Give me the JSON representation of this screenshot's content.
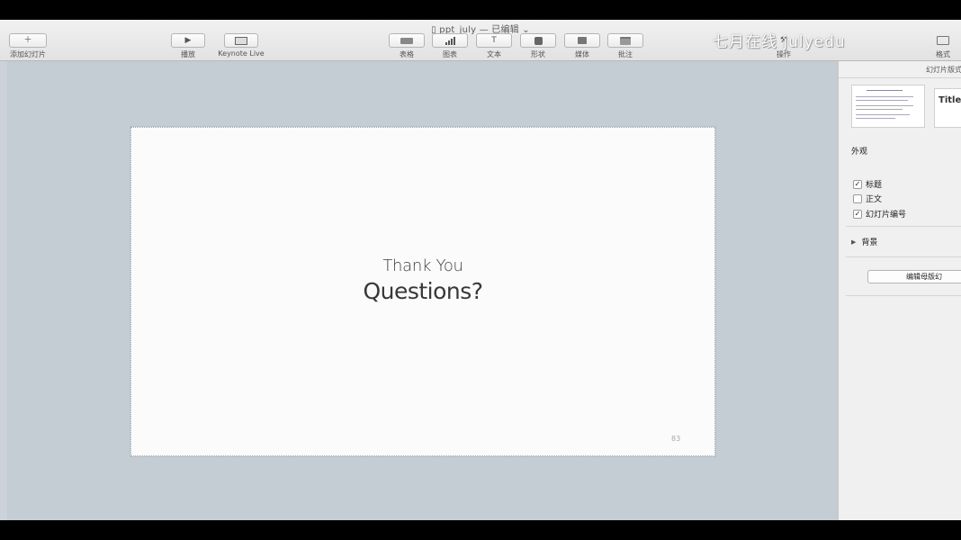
{
  "window": {
    "title": "ppt_july — 已编辑"
  },
  "toolbar": {
    "add_slide": "添加幻灯片",
    "play": "播放",
    "keynote_live": "Keynote Live",
    "table": "表格",
    "chart": "图表",
    "text": "文本",
    "shape": "形状",
    "media": "媒体",
    "comment": "批注",
    "action": "操作",
    "format": "格式"
  },
  "watermark": "七月在线 julyedu",
  "slide": {
    "line1": "Thank You",
    "line2": "Questions?",
    "number": "83"
  },
  "panel": {
    "tab_label": "幻灯片版式",
    "layout_thumb_title": "Title",
    "appearance_heading": "外观",
    "options": [
      {
        "label": "标题",
        "checked": true
      },
      {
        "label": "正文",
        "checked": false
      },
      {
        "label": "幻灯片编号",
        "checked": true
      }
    ],
    "background_label": "背景",
    "edit_master_button": "编辑母版幻"
  },
  "icons": {
    "add": "plus-icon",
    "play": "play-icon",
    "live": "keynote-live-icon",
    "check": "checkmark-icon",
    "disclosure": "disclosure-triangle-icon"
  }
}
